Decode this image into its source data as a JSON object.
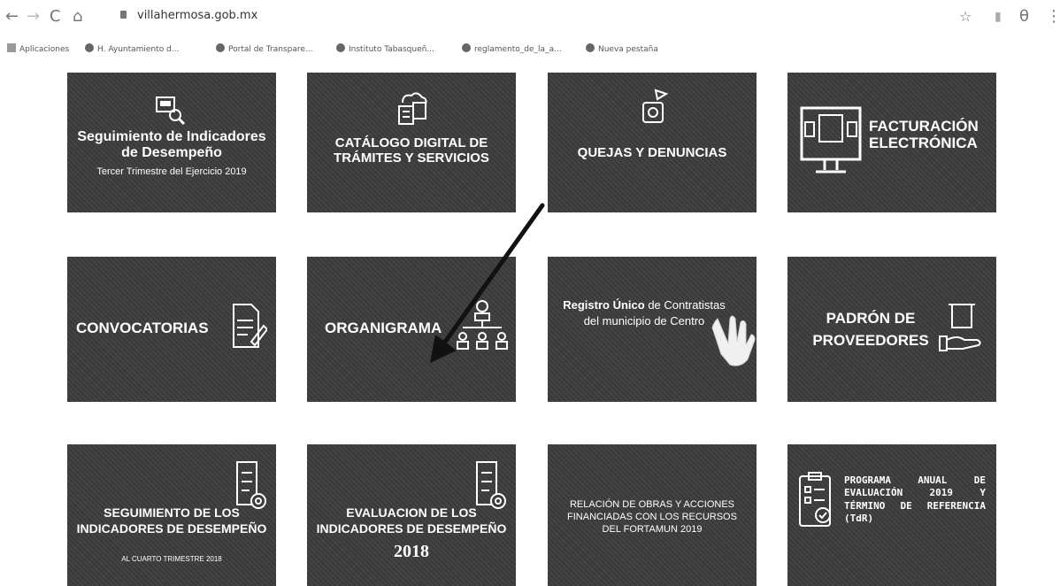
{
  "browser": {
    "url": "villahermosa.gob.mx",
    "nav": {
      "back": "←",
      "forward": "→",
      "reload": "C",
      "home": "⌂"
    },
    "right": {
      "star": "☆",
      "ext": "▮",
      "profile": "θ",
      "menu": "⋮"
    }
  },
  "bookmarks": [
    "Aplicaciones",
    "H. Ayuntamiento d...",
    "Portal de Transpare...",
    "Instituto Tabasqueñ...",
    "reglamento_de_la_a...",
    "Nueva pestaña"
  ],
  "tiles": {
    "r1c1": {
      "title": "Seguimiento de Indicadores de Desempeño",
      "subtitle": "Tercer Trimestre del Ejercicio 2019",
      "icon": "document-search-icon"
    },
    "r1c2": {
      "title": "CATÁLOGO DIGITAL DE TRÁMITES Y SERVICIOS",
      "icon": "cloud-documents-icon"
    },
    "r1c3": {
      "title": "QUEJAS Y DENUNCIAS",
      "icon": "complaint-icon"
    },
    "r1c4": {
      "title": "FACTURACIÓN ELECTRÓNICA",
      "icon": "monitor-icon"
    },
    "r2c1": {
      "title": "CONVOCATORIAS",
      "icon": "document-pencil-icon"
    },
    "r2c2": {
      "title": "ORGANIGRAMA",
      "icon": "org-chart-icon"
    },
    "r2c3": {
      "title_bold": "Registro Único",
      "title_rest": "de Contratistas del municipio de Centro",
      "icon": "hand-pointer-icon"
    },
    "r2c4": {
      "title": "PADRÓN DE PROVEEDORES",
      "icon": "hand-box-icon"
    },
    "r3c1": {
      "title": "SEGUIMIENTO DE LOS INDICADORES DE DESEMPEÑO",
      "subtitle": "AL CUARTO TRIMESTRE 2018",
      "icon": "clipboard-gear-icon"
    },
    "r3c2": {
      "title": "EVALUACION DE LOS INDICADORES DE DESEMPEÑO",
      "year": "2018",
      "icon": "clipboard-gear-icon"
    },
    "r3c3": {
      "title": "RELACIÓN DE OBRAS Y ACCIONES FINANCIADAS CON LOS RECURSOS DEL FORTAMUN 2019"
    },
    "r3c4": {
      "title": "PROGRAMA ANUAL DE EVALUACIÓN 2019 Y TÉRMINO DE REFERENCIA (TdR)",
      "icon": "clipboard-check-icon"
    }
  },
  "annotation": {
    "color": "#111111"
  }
}
